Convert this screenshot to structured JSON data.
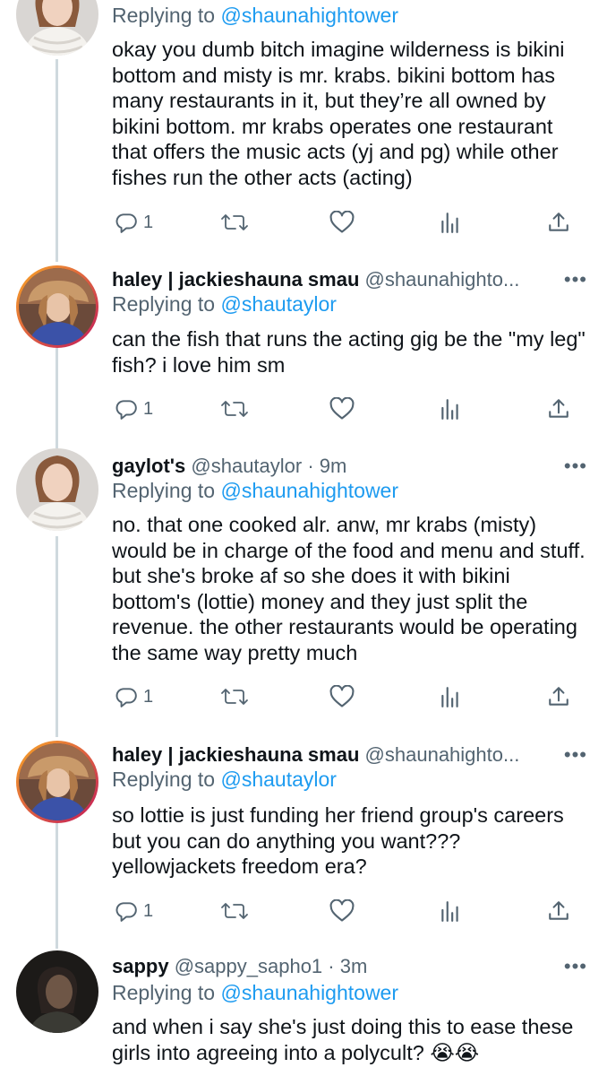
{
  "tweets": [
    {
      "display_name": "",
      "handle": "",
      "time": "",
      "replying_label": "Replying to",
      "replying_to": "@shaunahightower",
      "body": "okay you dumb bitch imagine wilderness is bikini bottom and misty is mr. krabs. bikini bottom has many restaurants in it, but they’re all owned by bikini bottom. mr krabs operates one restaurant that offers the music acts (yj and pg) while other fishes run the other acts (acting)",
      "reply_count": "1",
      "avatar": "woman-white-scarf-avatar"
    },
    {
      "display_name": "haley | jackieshauna smau",
      "handle": "@shaunahighto...",
      "time": "",
      "replying_label": "Replying to",
      "replying_to": "@shautaylor",
      "body": "can the fish that runs the acting gig be the \"my leg\" fish? i love him sm",
      "reply_count": "1",
      "avatar": "woman-cowboy-hat-avatar"
    },
    {
      "display_name": "gaylot's",
      "handle": "@shautaylor",
      "time": "· 9m",
      "replying_label": "Replying to",
      "replying_to": "@shaunahightower",
      "body": "no. that one cooked alr. anw, mr krabs (misty) would be in charge of the food and menu and stuff. but she's broke af so she does it with bikini bottom's (lottie) money and they just split the revenue. the other restaurants would be operating the same way pretty much",
      "reply_count": "1",
      "avatar": "woman-white-scarf-avatar"
    },
    {
      "display_name": "haley | jackieshauna smau",
      "handle": "@shaunahighto...",
      "time": "",
      "replying_label": "Replying to",
      "replying_to": "@shautaylor",
      "body": "so lottie is just funding her friend group's careers but you can do anything you want??? yellowjackets freedom era?",
      "reply_count": "1",
      "avatar": "woman-cowboy-hat-avatar"
    },
    {
      "display_name": "sappy",
      "handle": "@sappy_sapho1",
      "time": "· 3m",
      "replying_label": "Replying to",
      "replying_to": "@shaunahightower",
      "body": "and when i say she's just doing this to ease these girls into agreeing into a polycult? 😭😭",
      "reply_count": "",
      "avatar": "dark-photo-avatar"
    }
  ],
  "icons": {
    "reply": "reply-icon",
    "retweet": "retweet-icon",
    "like": "heart-icon",
    "views": "views-icon",
    "share": "share-icon",
    "more": "more-icon"
  },
  "more_glyph": "•••",
  "colors": {
    "accent": "#1d9bf0",
    "secondary_text": "#536471",
    "thread_line": "#cfd9de",
    "avatar_ring_start": "#f9a825",
    "avatar_ring_end": "#c2185b"
  }
}
